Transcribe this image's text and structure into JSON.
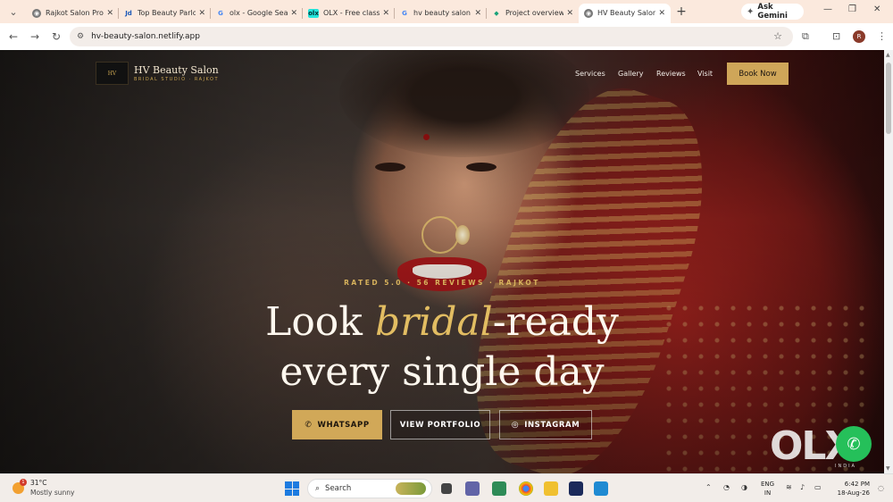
{
  "browser": {
    "tabs": [
      {
        "label": "Rajkot Salon Pro",
        "favicon": "globe-icon"
      },
      {
        "label": "Top Beauty Parlo",
        "favicon": "justdial-icon"
      },
      {
        "label": "olx - Google Sea",
        "favicon": "google-icon"
      },
      {
        "label": "OLX - Free classi",
        "favicon": "olx-icon"
      },
      {
        "label": "hv beauty salon",
        "favicon": "google-icon"
      },
      {
        "label": "Project overview",
        "favicon": "diamond-icon"
      },
      {
        "label": "HV Beauty Salon",
        "favicon": "globe-icon",
        "active": true
      }
    ],
    "gemini_label": "Ask Gemini",
    "url": "hv-beauty-salon.netlify.app",
    "profile_initial": "R"
  },
  "site": {
    "brand": {
      "logo_text": "HV",
      "name": "HV Beauty Salon",
      "tagline": "BRIDAL STUDIO · RAJKOT"
    },
    "nav": [
      "Services",
      "Gallery",
      "Reviews",
      "Visit"
    ],
    "book_label": "Book Now",
    "hero": {
      "kicker": "RATED 5.0 · 56 REVIEWS · RAJKOT",
      "line1_pre": "Look ",
      "line1_highlight": "bridal",
      "line1_post": "-ready",
      "line2": "every single day",
      "buttons": [
        {
          "label": "WHATSAPP",
          "icon": "whatsapp-icon"
        },
        {
          "label": "VIEW PORTFOLIO"
        },
        {
          "label": "INSTAGRAM",
          "icon": "instagram-icon"
        }
      ]
    },
    "overlay": {
      "olx_text": "OLX",
      "olx_sub": "INDIA"
    },
    "colors": {
      "gold": "#cfa659",
      "headline_highlight": "#e2bd62"
    }
  },
  "taskbar": {
    "weather": {
      "temp": "31°C",
      "condition": "Mostly sunny",
      "badge": "1"
    },
    "search_placeholder": "Search",
    "lang": {
      "line1": "ENG",
      "line2": "IN"
    },
    "time": "6:42 PM",
    "date": "18-Aug-26"
  }
}
